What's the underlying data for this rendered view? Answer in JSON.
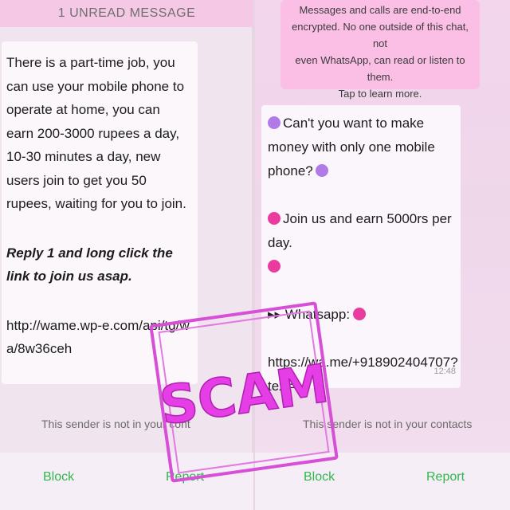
{
  "left_chat": {
    "unread_banner": "1 UNREAD MESSAGE",
    "message": {
      "paragraph1": "There is a part-time job, you can use your mobile phone to operate at home, you can earn 200-3000 rupees a day, 10-30 minutes a day, new users join to get you 50 rupees, waiting for you to join.",
      "paragraph2": "Reply 1 and long click the link to join us asap.",
      "link": "http://wame.wp-e.com/api/tg/wa/8w36ceh"
    },
    "sender_note": "This sender is not in your cont",
    "block_label": "Block",
    "report_label": "Report"
  },
  "right_chat": {
    "encryption_notice": {
      "line1": "Messages and calls are end-to-end",
      "line2": "encrypted. No one outside of this chat, not",
      "line3": "even WhatsApp, can read or listen to them.",
      "line4": "Tap to learn more."
    },
    "message": {
      "line1": "Can't you want to make money with only one mobile phone?",
      "line2": "Join us and earn 5000rs per day.",
      "line3": "Whatsapp:",
      "line4": "https://wa.me/+918902404707?",
      "line4_suffix": "text=...",
      "time": "12:48"
    },
    "sender_note": "This sender is not in your contacts",
    "block_label": "Block",
    "report_label": "Report"
  },
  "stamp": {
    "text": "SCAM",
    "color": "#e63ee6"
  },
  "colors": {
    "action_green": "#2fb84b",
    "banner_pink": "#f5c8e6",
    "notice_pink": "#fbbfe6"
  }
}
